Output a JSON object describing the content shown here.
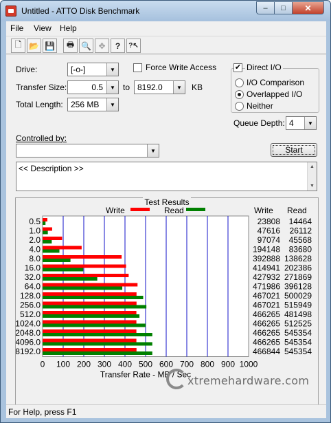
{
  "window": {
    "title": "Untitled - ATTO Disk Benchmark",
    "controls": {
      "minimize": "–",
      "maximize": "□",
      "close": "✕"
    }
  },
  "menu": [
    "File",
    "View",
    "Help"
  ],
  "toolbar": {
    "icons": [
      "new-file-icon",
      "open-folder-icon",
      "save-icon",
      "print-icon",
      "print-preview-icon",
      "move-icon",
      "help-icon",
      "context-help-icon"
    ],
    "glyphs": [
      "🗋",
      "📂",
      "💾",
      "🖶",
      "🔍",
      "✥",
      "?",
      "?↖"
    ]
  },
  "settings": {
    "drive_label": "Drive:",
    "drive_value": "[-o-]",
    "force_write_label": "Force Write Access",
    "force_write_checked": false,
    "direct_io_label": "Direct I/O",
    "direct_io_checked": true,
    "transfer_size_label": "Transfer Size:",
    "transfer_from": "0.5",
    "to_label": "to",
    "transfer_to": "8192.0",
    "kb_label": "KB",
    "total_length_label": "Total Length:",
    "total_length": "256 MB",
    "io_comparison_label": "I/O Comparison",
    "overlapped_io_label": "Overlapped I/O",
    "neither_label": "Neither",
    "selected_mode": "Overlapped I/O",
    "queue_depth_label": "Queue Depth:",
    "queue_depth": "4",
    "controlled_by_label": "Controlled by:",
    "controlled_by_value": "",
    "start_label": "Start",
    "description": "<< Description >>"
  },
  "results": {
    "title": "Test Results",
    "write_legend": "Write",
    "read_legend": "Read",
    "write_col": "Write",
    "read_col": "Read"
  },
  "colors": {
    "write": "#ff0000",
    "read": "#008000",
    "grid": "#1010c8"
  },
  "chart_data": {
    "type": "bar",
    "orientation": "horizontal",
    "xlabel": "Transfer Rate - MB / Sec",
    "xlim": [
      0,
      1000
    ],
    "xticks": [
      0,
      100,
      200,
      300,
      400,
      500,
      600,
      700,
      800,
      900,
      1000
    ],
    "categories": [
      "0.5",
      "1.0",
      "2.0",
      "4.0",
      "8.0",
      "16.0",
      "32.0",
      "64.0",
      "128.0",
      "256.0",
      "512.0",
      "1024.0",
      "2048.0",
      "4096.0",
      "8192.0"
    ],
    "series": [
      {
        "name": "Write",
        "values": [
          23808,
          47616,
          97074,
          194148,
          392888,
          414941,
          427932,
          471986,
          467021,
          467021,
          466265,
          466265,
          466265,
          466265,
          466844
        ]
      },
      {
        "name": "Read",
        "values": [
          14464,
          26112,
          45568,
          83680,
          138628,
          202386,
          271869,
          396128,
          500029,
          515949,
          481498,
          512525,
          545354,
          545354,
          545354
        ]
      }
    ]
  },
  "statusbar": {
    "text": "For Help, press F1"
  },
  "watermark": "xtremehardware.com"
}
